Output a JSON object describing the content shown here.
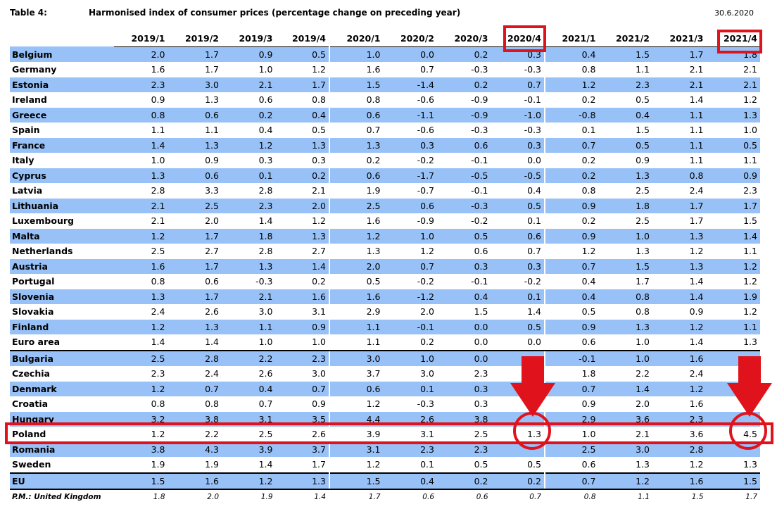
{
  "header": {
    "table_label": "Table 4:",
    "title": "Harmonised index of consumer prices (percentage change on preceding year)",
    "date": "30.6.2020"
  },
  "columns": [
    "2019/1",
    "2019/2",
    "2019/3",
    "2019/4",
    "2020/1",
    "2020/2",
    "2020/3",
    "2020/4",
    "2021/1",
    "2021/2",
    "2021/3",
    "2021/4"
  ],
  "rows": [
    {
      "label": "Belgium",
      "values": [
        "2.0",
        "1.7",
        "0.9",
        "0.5",
        "1.0",
        "0.0",
        "0.2",
        "0.3",
        "0.4",
        "1.5",
        "1.7",
        "1.8"
      ]
    },
    {
      "label": "Germany",
      "values": [
        "1.6",
        "1.7",
        "1.0",
        "1.2",
        "1.6",
        "0.7",
        "-0.3",
        "-0.3",
        "0.8",
        "1.1",
        "2.1",
        "2.1"
      ]
    },
    {
      "label": "Estonia",
      "values": [
        "2.3",
        "3.0",
        "2.1",
        "1.7",
        "1.5",
        "-1.4",
        "0.2",
        "0.7",
        "1.2",
        "2.3",
        "2.1",
        "2.1"
      ]
    },
    {
      "label": "Ireland",
      "values": [
        "0.9",
        "1.3",
        "0.6",
        "0.8",
        "0.8",
        "-0.6",
        "-0.9",
        "-0.1",
        "0.2",
        "0.5",
        "1.4",
        "1.2"
      ]
    },
    {
      "label": "Greece",
      "values": [
        "0.8",
        "0.6",
        "0.2",
        "0.4",
        "0.6",
        "-1.1",
        "-0.9",
        "-1.0",
        "-0.8",
        "0.4",
        "1.1",
        "1.3"
      ]
    },
    {
      "label": "Spain",
      "values": [
        "1.1",
        "1.1",
        "0.4",
        "0.5",
        "0.7",
        "-0.6",
        "-0.3",
        "-0.3",
        "0.1",
        "1.5",
        "1.1",
        "1.0"
      ]
    },
    {
      "label": "France",
      "values": [
        "1.4",
        "1.3",
        "1.2",
        "1.3",
        "1.3",
        "0.3",
        "0.6",
        "0.3",
        "0.7",
        "0.5",
        "1.1",
        "0.5"
      ]
    },
    {
      "label": "Italy",
      "values": [
        "1.0",
        "0.9",
        "0.3",
        "0.3",
        "0.2",
        "-0.2",
        "-0.1",
        "0.0",
        "0.2",
        "0.9",
        "1.1",
        "1.1"
      ]
    },
    {
      "label": "Cyprus",
      "values": [
        "1.3",
        "0.6",
        "0.1",
        "0.2",
        "0.6",
        "-1.7",
        "-0.5",
        "-0.5",
        "0.2",
        "1.3",
        "0.8",
        "0.9"
      ]
    },
    {
      "label": "Latvia",
      "values": [
        "2.8",
        "3.3",
        "2.8",
        "2.1",
        "1.9",
        "-0.7",
        "-0.1",
        "0.4",
        "0.8",
        "2.5",
        "2.4",
        "2.3"
      ]
    },
    {
      "label": "Lithuania",
      "values": [
        "2.1",
        "2.5",
        "2.3",
        "2.0",
        "2.5",
        "0.6",
        "-0.3",
        "0.5",
        "0.9",
        "1.8",
        "1.7",
        "1.7"
      ]
    },
    {
      "label": "Luxembourg",
      "values": [
        "2.1",
        "2.0",
        "1.4",
        "1.2",
        "1.6",
        "-0.9",
        "-0.2",
        "0.1",
        "0.2",
        "2.5",
        "1.7",
        "1.5"
      ]
    },
    {
      "label": "Malta",
      "values": [
        "1.2",
        "1.7",
        "1.8",
        "1.3",
        "1.2",
        "1.0",
        "0.5",
        "0.6",
        "0.9",
        "1.0",
        "1.3",
        "1.4"
      ]
    },
    {
      "label": "Netherlands",
      "values": [
        "2.5",
        "2.7",
        "2.8",
        "2.7",
        "1.3",
        "1.2",
        "0.6",
        "0.7",
        "1.2",
        "1.3",
        "1.2",
        "1.1"
      ]
    },
    {
      "label": "Austria",
      "values": [
        "1.6",
        "1.7",
        "1.3",
        "1.4",
        "2.0",
        "0.7",
        "0.3",
        "0.3",
        "0.7",
        "1.5",
        "1.3",
        "1.2"
      ]
    },
    {
      "label": "Portugal",
      "values": [
        "0.8",
        "0.6",
        "-0.3",
        "0.2",
        "0.5",
        "-0.2",
        "-0.1",
        "-0.2",
        "0.4",
        "1.7",
        "1.4",
        "1.2"
      ]
    },
    {
      "label": "Slovenia",
      "values": [
        "1.3",
        "1.7",
        "2.1",
        "1.6",
        "1.6",
        "-1.2",
        "0.4",
        "0.1",
        "0.4",
        "0.8",
        "1.4",
        "1.9"
      ]
    },
    {
      "label": "Slovakia",
      "values": [
        "2.4",
        "2.6",
        "3.0",
        "3.1",
        "2.9",
        "2.0",
        "1.5",
        "1.4",
        "0.5",
        "0.8",
        "0.9",
        "1.2"
      ]
    },
    {
      "label": "Finland",
      "values": [
        "1.2",
        "1.3",
        "1.1",
        "0.9",
        "1.1",
        "-0.1",
        "0.0",
        "0.5",
        "0.9",
        "1.3",
        "1.2",
        "1.1"
      ]
    },
    {
      "label": "Euro area",
      "values": [
        "1.4",
        "1.4",
        "1.0",
        "1.0",
        "1.1",
        "0.2",
        "0.0",
        "0.0",
        "0.6",
        "1.0",
        "1.4",
        "1.3"
      ]
    },
    {
      "label": "Bulgaria",
      "values": [
        "2.5",
        "2.8",
        "2.2",
        "2.3",
        "3.0",
        "1.0",
        "0.0",
        "",
        "-0.1",
        "1.0",
        "1.6",
        ""
      ]
    },
    {
      "label": "Czechia",
      "values": [
        "2.3",
        "2.4",
        "2.6",
        "3.0",
        "3.7",
        "3.0",
        "2.3",
        "",
        "1.8",
        "2.2",
        "2.4",
        ""
      ]
    },
    {
      "label": "Denmark",
      "values": [
        "1.2",
        "0.7",
        "0.4",
        "0.7",
        "0.6",
        "0.1",
        "0.3",
        "",
        "0.7",
        "1.4",
        "1.2",
        ""
      ]
    },
    {
      "label": "Croatia",
      "values": [
        "0.8",
        "0.8",
        "0.7",
        "0.9",
        "1.2",
        "-0.3",
        "0.3",
        "",
        "0.9",
        "2.0",
        "1.6",
        ""
      ]
    },
    {
      "label": "Hungary",
      "values": [
        "3.2",
        "3.8",
        "3.1",
        "3.5",
        "4.4",
        "2.6",
        "3.8",
        "",
        "2.9",
        "3.6",
        "2.3",
        ""
      ]
    },
    {
      "label": "Poland",
      "values": [
        "1.2",
        "2.2",
        "2.5",
        "2.6",
        "3.9",
        "3.1",
        "2.5",
        "1.3",
        "1.0",
        "2.1",
        "3.6",
        "4.5"
      ]
    },
    {
      "label": "Romania",
      "values": [
        "3.8",
        "4.3",
        "3.9",
        "3.7",
        "3.1",
        "2.3",
        "2.3",
        "",
        "2.5",
        "3.0",
        "2.8",
        ""
      ]
    },
    {
      "label": "Sweden",
      "values": [
        "1.9",
        "1.9",
        "1.4",
        "1.7",
        "1.2",
        "0.1",
        "0.5",
        "0.5",
        "0.6",
        "1.3",
        "1.2",
        "1.3"
      ]
    },
    {
      "label": "EU",
      "values": [
        "1.5",
        "1.6",
        "1.2",
        "1.3",
        "1.5",
        "0.4",
        "0.2",
        "0.2",
        "0.7",
        "1.2",
        "1.6",
        "1.5"
      ]
    },
    {
      "label": "P.M.: United Kingdom",
      "values": [
        "1.8",
        "2.0",
        "1.9",
        "1.4",
        "1.7",
        "0.6",
        "0.6",
        "0.7",
        "0.8",
        "1.1",
        "1.5",
        "1.7"
      ]
    }
  ],
  "annotations": {
    "color": "#e0121c",
    "boxed_columns": [
      "2020/4",
      "2021/4"
    ],
    "boxed_row": "Poland",
    "circled_values": [
      "1.3",
      "4.5"
    ],
    "arrows": "down-arrow"
  }
}
